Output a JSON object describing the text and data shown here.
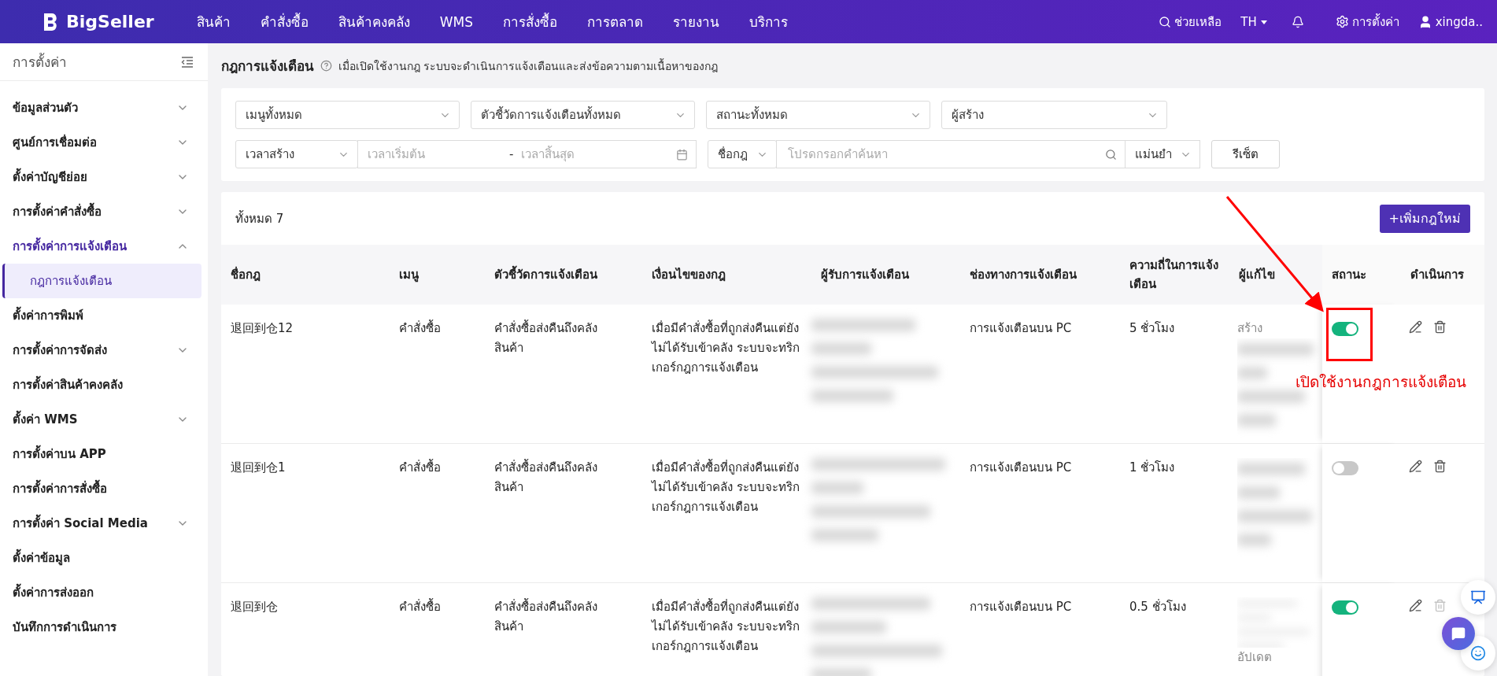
{
  "topbar": {
    "logo": "BigSeller",
    "nav": [
      {
        "label": "สินค้า"
      },
      {
        "label": "คำสั่งซื้อ"
      },
      {
        "label": "สินค้าคงคลัง"
      },
      {
        "label": "WMS"
      },
      {
        "label": "การสั่งซื้อ"
      },
      {
        "label": "การตลาด"
      },
      {
        "label": "รายงาน"
      },
      {
        "label": "บริการ"
      }
    ],
    "help": "ช่วยเหลือ",
    "language": "TH",
    "settings": "การตั้งค่า",
    "user": "xingda.."
  },
  "sidebar": {
    "title": "การตั้งค่า",
    "items": [
      {
        "label": "ข้อมูลส่วนตัว",
        "kind": "group",
        "expanded": false,
        "selected": false
      },
      {
        "label": "ศูนย์การเชื่อมต่อ",
        "kind": "group",
        "expanded": false,
        "selected": false
      },
      {
        "label": "ตั้งค่าบัญชีย่อย",
        "kind": "group",
        "expanded": false,
        "selected": false
      },
      {
        "label": "การตั้งค่าคำสั่งซื้อ",
        "kind": "group",
        "expanded": false,
        "selected": false
      },
      {
        "label": "การตั้งค่าการแจ้งเตือน",
        "kind": "group",
        "expanded": true,
        "selected": true,
        "children": [
          {
            "label": "กฎการแจ้งเตือน",
            "selected": true
          }
        ]
      },
      {
        "label": "ตั้งค่าการพิมพ์",
        "kind": "link",
        "selected": false
      },
      {
        "label": "การตั้งค่าการจัดส่ง",
        "kind": "group",
        "expanded": false,
        "selected": false
      },
      {
        "label": "การตั้งค่าสินค้าคงคลัง",
        "kind": "link",
        "selected": false
      },
      {
        "label": "ตั้งค่า WMS",
        "kind": "group",
        "expanded": false,
        "selected": false
      },
      {
        "label": "การตั้งค่าบน APP",
        "kind": "link",
        "selected": false
      },
      {
        "label": "การตั้งค่าการสั่งซื้อ",
        "kind": "link",
        "selected": false
      },
      {
        "label": "การตั้งค่า Social Media",
        "kind": "group",
        "expanded": false,
        "selected": false
      },
      {
        "label": "ตั้งค่าข้อมูล",
        "kind": "link",
        "selected": false
      },
      {
        "label": "ตั้งค่าการส่งออก",
        "kind": "link",
        "selected": false
      },
      {
        "label": "บันทึกการดำเนินการ",
        "kind": "link",
        "selected": false
      }
    ]
  },
  "page": {
    "title": "กฎการแจ้งเตือน",
    "description": "เมื่อเปิดใช้งานกฎ ระบบจะดำเนินการแจ้งเตือนและส่งข้อความตามเนื้อหาของกฎ"
  },
  "filters": {
    "menu": "เมนูทั้งหมด",
    "metric": "ตัวชี้วัดการแจ้งเตือนทั้งหมด",
    "status": "สถานะทั้งหมด",
    "creator": "ผู้สร้าง",
    "time_type": "เวลาสร้าง",
    "start_placeholder": "เวลาเริ่มต้น",
    "separator": "-",
    "end_placeholder": "เวลาสิ้นสุด",
    "search_field": "ชื่อกฎ",
    "search_placeholder": "โปรดกรอกคำค้นหา",
    "match": "แม่นยำ",
    "reset": "รีเซ็ต"
  },
  "table": {
    "total": "ทั้งหมด 7",
    "add_button": "+เพิ่มกฎใหม่",
    "columns": [
      "ชื่อกฎ",
      "เมนู",
      "ตัวชี้วัดการแจ้งเตือน",
      "เงื่อนไขของกฎ",
      "ผู้รับการแจ้งเตือน",
      "ช่องทางการแจ้งเตือน",
      "ความถี่ในการแจ้งเตือน",
      "ผู้แก้ไข",
      "สถานะ",
      "ดำเนินการ"
    ],
    "rows": [
      {
        "name": "退回到仓12",
        "menu": "คำสั่งซื้อ",
        "metric": "คำสั่งซื้อส่งคืนถึงคลังสินค้า",
        "condition": "เมื่อมีคำสั่งซื้อที่ถูกส่งคืนแต่ยังไม่ได้รับเข้าคลัง ระบบจะทริกเกอร์กฎการแจ้งเตือน",
        "channel": "การแจ้งเตือนบน PC",
        "frequency": "5 ชั่วโมง",
        "editor_top": "สร้าง",
        "on": true,
        "delete_disabled": false
      },
      {
        "name": "退回到仓1",
        "menu": "คำสั่งซื้อ",
        "metric": "คำสั่งซื้อส่งคืนถึงคลังสินค้า",
        "condition": "เมื่อมีคำสั่งซื้อที่ถูกส่งคืนแต่ยังไม่ได้รับเข้าคลัง ระบบจะทริกเกอร์กฎการแจ้งเตือน",
        "channel": "การแจ้งเตือนบน PC",
        "frequency": "1 ชั่วโมง",
        "on": false,
        "delete_disabled": false
      },
      {
        "name": "退回到仓",
        "menu": "คำสั่งซื้อ",
        "metric": "คำสั่งซื้อส่งคืนถึงคลังสินค้า",
        "condition": "เมื่อมีคำสั่งซื้อที่ถูกส่งคืนแต่ยังไม่ได้รับเข้าคลัง ระบบจะทริกเกอร์กฎการแจ้งเตือน",
        "channel": "การแจ้งเตือนบน PC",
        "frequency": "0.5 ชั่วโมง",
        "editor_bottom": "อัปเดต",
        "on": true,
        "delete_disabled": true
      }
    ]
  },
  "annotation": {
    "text": "เปิดใช้งานกฎการแจ้งเตือน"
  }
}
